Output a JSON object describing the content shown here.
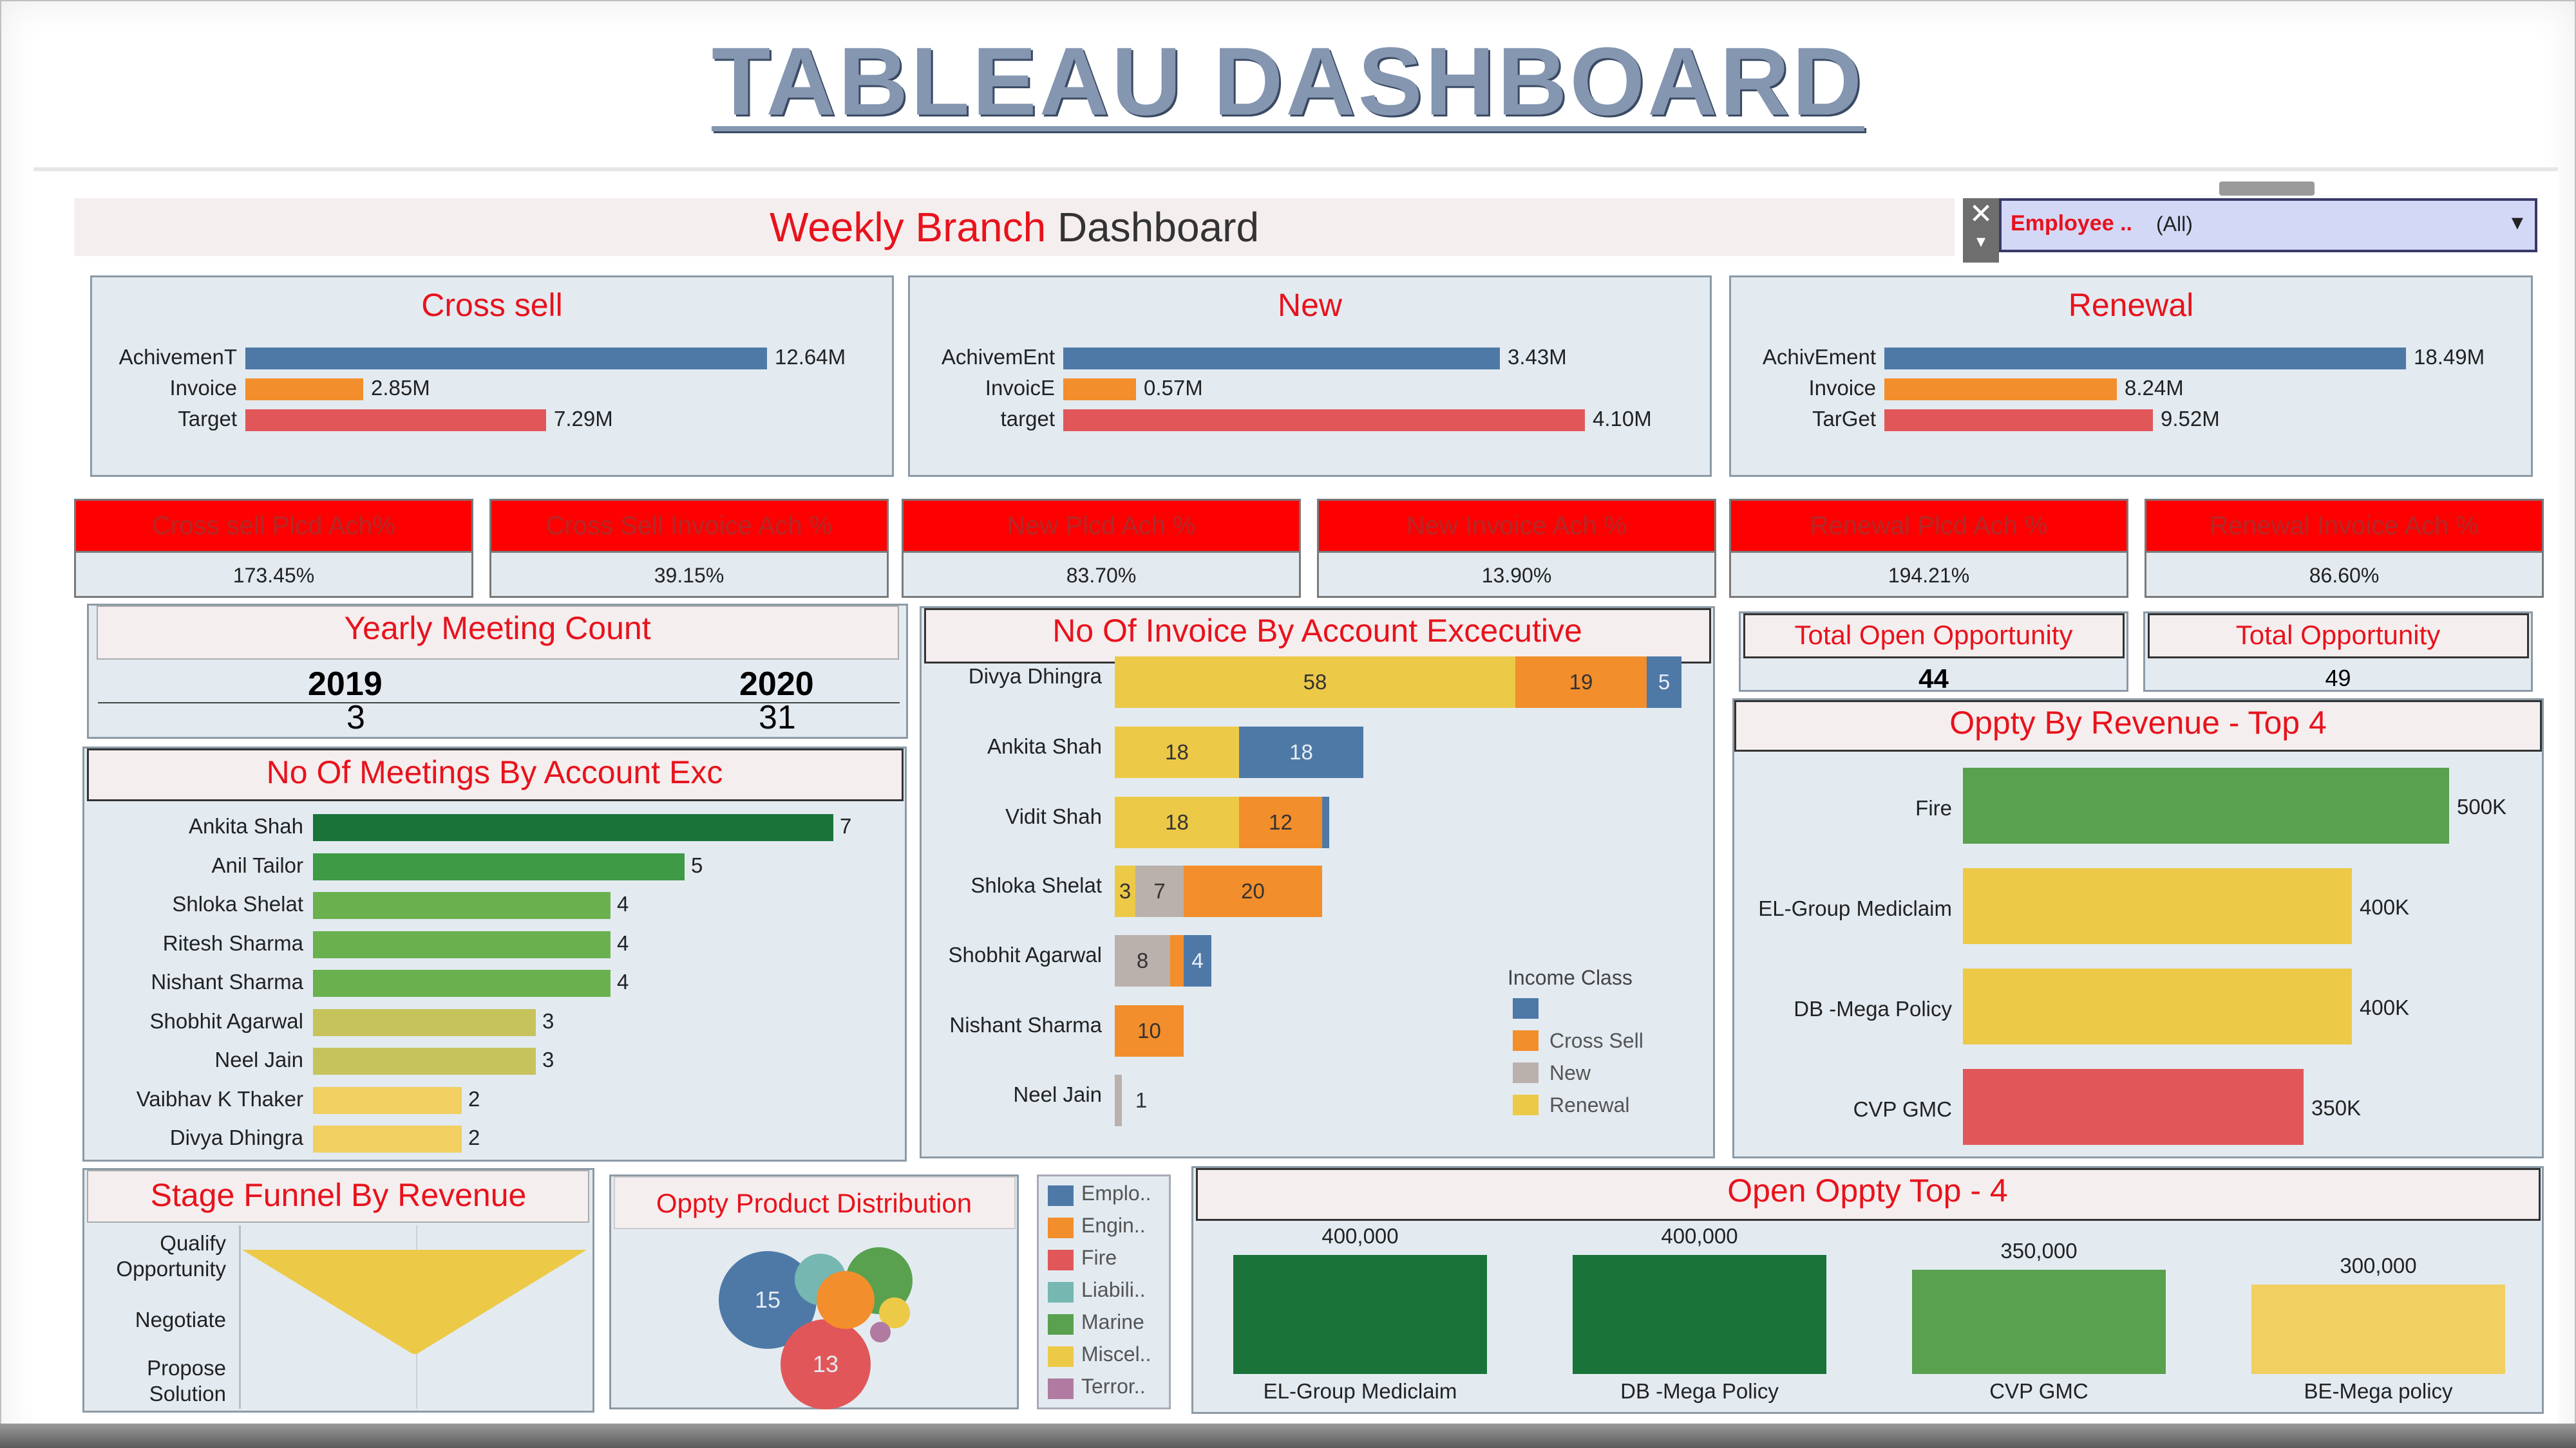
{
  "slide_title": "TABLEAU DASHBOARD",
  "dashboard": {
    "title_part1": "Weekly Branch",
    "title_part2": "Dashboard",
    "filter": {
      "label": "Employee ..",
      "value": "(All)"
    }
  },
  "summary_panels": [
    {
      "title": "Cross sell",
      "rows": [
        {
          "label": "AchivemenT",
          "value": "12.64M",
          "amount": 12.64
        },
        {
          "label": "Invoice",
          "value": "2.85M",
          "amount": 2.85
        },
        {
          "label": "Target",
          "value": "7.29M",
          "amount": 7.29
        }
      ]
    },
    {
      "title": "New",
      "rows": [
        {
          "label": "AchivemEnt",
          "value": "3.43M",
          "amount": 3.43
        },
        {
          "label": "InvoicE",
          "value": "0.57M",
          "amount": 0.57
        },
        {
          "label": "target",
          "value": "4.10M",
          "amount": 4.1
        }
      ]
    },
    {
      "title": "Renewal",
      "rows": [
        {
          "label": "AchivEment",
          "value": "18.49M",
          "amount": 18.49
        },
        {
          "label": "Invoice",
          "value": "8.24M",
          "amount": 8.24
        },
        {
          "label": "TarGet",
          "value": "9.52M",
          "amount": 9.52
        }
      ]
    }
  ],
  "kpis": [
    {
      "label": "Cross sell Plcd Ach%",
      "value": "173.45%"
    },
    {
      "label": "Cross Sell Invoice Ach %",
      "value": "39.15%"
    },
    {
      "label": "New Plcd Ach %",
      "value": "83.70%"
    },
    {
      "label": "New Invoice Ach %",
      "value": "13.90%"
    },
    {
      "label": "Renewal Plcd Ach %",
      "value": "194.21%"
    },
    {
      "label": "Renewal Invoice Ach %",
      "value": "86.60%"
    }
  ],
  "yearly_meeting": {
    "title": "Yearly Meeting Count",
    "years": [
      "2019",
      "2020"
    ],
    "counts": [
      "3",
      "31"
    ]
  },
  "meetings_by_exec": {
    "title": "No Of Meetings By Account Exc"
  },
  "invoice_by_exec": {
    "title": "No Of Invoice By Account Excecutive",
    "legend_title": "Income Class",
    "legend": [
      "",
      "Cross Sell",
      "New",
      "Renewal"
    ]
  },
  "open_opportunity": {
    "total_open_label": "Total Open Opportunity",
    "total_open": "44",
    "total_label": "Total Opportunity",
    "total": "49"
  },
  "oppty_revenue": {
    "title": "Oppty By Revenue - Top 4"
  },
  "stage_funnel": {
    "title": "Stage Funnel By Revenue",
    "stages": [
      "Qualify Opportunity",
      "Negotiate",
      "Propose Solution"
    ]
  },
  "product_dist": {
    "title": "Oppty Product Distribution",
    "bubble_labels": [
      "15",
      "13"
    ],
    "legend": [
      "Emplo..",
      "Engin..",
      "Fire",
      "Liabili..",
      "Marine",
      "Miscel..",
      "Terror.."
    ]
  },
  "open_top4": {
    "title": "Open Oppty Top - 4"
  },
  "colors": {
    "blue": "#4e79a7",
    "orange": "#f28e2b",
    "red": "#e15759",
    "gray": "#bab0ac",
    "yellow": "#edc948",
    "green_dark": "#1a7339",
    "green": "#59a14f",
    "accent_red": "#e8121c"
  },
  "chart_data": [
    {
      "type": "bar",
      "title": "No Of Meetings By Account Exc",
      "categories": [
        "Ankita Shah",
        "Anil Tailor",
        "Shloka Shelat",
        "Ritesh Sharma",
        "Nishant Sharma",
        "Shobhit Agarwal",
        "Neel Jain",
        "Vaibhav K Thaker",
        "Divya Dhingra"
      ],
      "values": [
        7,
        5,
        4,
        4,
        4,
        3,
        3,
        2,
        2
      ]
    },
    {
      "type": "bar",
      "title": "No Of Invoice By Account Excecutive",
      "categories": [
        "Divya Dhingra",
        "Ankita Shah",
        "Vidit Shah",
        "Shloka Shelat",
        "Shobhit Agarwal",
        "Nishant Sharma",
        "Neel Jain"
      ],
      "series": [
        {
          "name": "Renewal",
          "values": [
            58,
            18,
            18,
            3,
            0,
            0,
            0
          ]
        },
        {
          "name": "New",
          "values": [
            0,
            0,
            0,
            7,
            8,
            0,
            1
          ]
        },
        {
          "name": "Cross Sell",
          "values": [
            19,
            0,
            12,
            20,
            2,
            10,
            0
          ]
        },
        {
          "name": "",
          "values": [
            5,
            18,
            1,
            0,
            4,
            0,
            0
          ]
        }
      ]
    },
    {
      "type": "bar",
      "title": "Oppty By Revenue - Top 4",
      "categories": [
        "Fire",
        "EL-Group Mediclaim",
        "DB -Mega Policy",
        "CVP GMC"
      ],
      "values": [
        500000,
        400000,
        400000,
        350000
      ],
      "value_labels": [
        "500K",
        "400K",
        "400K",
        "350K"
      ]
    },
    {
      "type": "bar",
      "title": "Open Oppty Top - 4",
      "categories": [
        "EL-Group Mediclaim",
        "DB -Mega Policy",
        "CVP GMC",
        "BE-Mega policy"
      ],
      "values": [
        400000,
        400000,
        350000,
        300000
      ],
      "value_labels": [
        "400,000",
        "400,000",
        "350,000",
        "300,000"
      ]
    }
  ]
}
